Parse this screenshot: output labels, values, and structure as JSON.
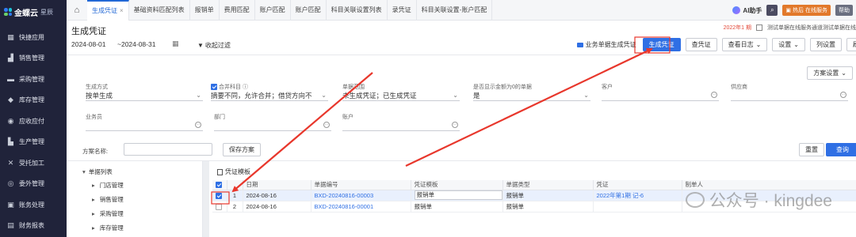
{
  "sidebar": {
    "logo_text": "金蝶云",
    "logo_sub": "星辰",
    "items": [
      {
        "label": "快捷应用",
        "icon": "grid-icon"
      },
      {
        "label": "销售管理",
        "icon": "chart-icon"
      },
      {
        "label": "采购管理",
        "icon": "cart-icon"
      },
      {
        "label": "库存管理",
        "icon": "box-icon"
      },
      {
        "label": "应收应付",
        "icon": "money-icon"
      },
      {
        "label": "生产管理",
        "icon": "factory-icon"
      },
      {
        "label": "受托加工",
        "icon": "tools-icon"
      },
      {
        "label": "委外管理",
        "icon": "outsource-icon"
      },
      {
        "label": "账务处理",
        "icon": "ledger-icon"
      },
      {
        "label": "财务报表",
        "icon": "report-icon"
      }
    ]
  },
  "tabs": [
    {
      "label": "生成凭证",
      "active": true,
      "closable": true
    },
    {
      "label": "基础资料匹配列表"
    },
    {
      "label": "报销单"
    },
    {
      "label": "费用匹配"
    },
    {
      "label": "账户匹配"
    },
    {
      "label": "账户匹配"
    },
    {
      "label": "科目关联设置列表"
    },
    {
      "label": "录凭证"
    },
    {
      "label": "科目关联设置-账户匹配"
    }
  ],
  "topbar": {
    "ai_label": "AI助手",
    "promo_label": "热后 在线服务",
    "help_label": "帮助"
  },
  "page": {
    "title": "生成凭证",
    "notice_prefix": "2022年1 期",
    "notice_text": "测试单据在线服务通道测试单据在线"
  },
  "filter": {
    "date_from": "2024-08-01",
    "date_to": "~2024-08-31",
    "collapse_label": "收起过滤",
    "toolbar": {
      "doc_gen": "业务单据生成凭证",
      "gen": "生成凭证",
      "view_voucher": "查凭证",
      "view_log": "查看日志",
      "settings": "设置",
      "col_settings": "列设置",
      "refresh": "刷新"
    }
  },
  "scheme": {
    "select_label": "方案设置",
    "fields": [
      {
        "label": "生成方式",
        "value": "按单生成",
        "kind": "select"
      },
      {
        "label": "合并科目",
        "value": "摘要不同，允许合并；借贷方向不",
        "kind": "select",
        "checked": true
      },
      {
        "label": "单据范围",
        "value": "未生成凭证；已生成凭证",
        "kind": "select"
      },
      {
        "label": "是否显示金额为0的单据",
        "value": "是",
        "kind": "select"
      },
      {
        "label": "客户",
        "value": "",
        "kind": "lookup"
      },
      {
        "label": "供应商",
        "value": "",
        "kind": "lookup"
      },
      {
        "label": "业务员",
        "value": "",
        "kind": "lookup"
      },
      {
        "label": "部门",
        "value": "",
        "kind": "lookup"
      },
      {
        "label": "账户",
        "value": "",
        "kind": "lookup"
      }
    ],
    "name_label": "方案名称:",
    "name_value": "",
    "save_label": "保存方案",
    "reset_label": "重置",
    "query_label": "查询"
  },
  "tree": {
    "root": "单据列表",
    "items": [
      "门店管理",
      "销售管理",
      "采购管理",
      "库存管理"
    ]
  },
  "grid": {
    "template_label": "凭证模板",
    "columns": [
      "",
      "",
      "日期",
      "单据编号",
      "凭证模板",
      "单据类型",
      "凭证",
      "制单人"
    ],
    "rows": [
      {
        "checked": true,
        "no": "1",
        "date": "2024-08-16",
        "bill_no": "BXD-20240816-00003",
        "template": "报销单",
        "type": "报销单",
        "voucher": "2022年第1期 记-6",
        "maker": ""
      },
      {
        "checked": false,
        "no": "2",
        "date": "2024-08-16",
        "bill_no": "BXD-20240816-00001",
        "template": "报销单",
        "type": "报销单",
        "voucher": "",
        "maker": ""
      }
    ]
  },
  "watermark": {
    "text": "公众号 · kingdee"
  },
  "colors": {
    "accent": "#2f6fe4",
    "sidebar": "#20233a",
    "annotation": "#e8372c"
  }
}
